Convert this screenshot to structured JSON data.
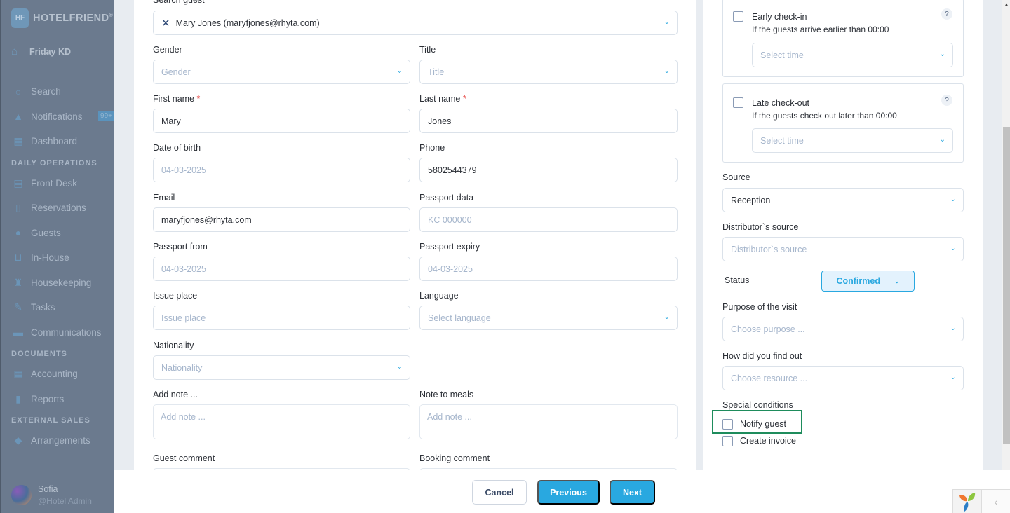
{
  "sidebar": {
    "brand": "HOTELFRIEND",
    "brand_mark": "®",
    "logo_letters": "HF",
    "hotel": "Friday KD",
    "items_top": [
      {
        "label": "Search",
        "icon": "search-icon"
      },
      {
        "label": "Notifications",
        "icon": "bell-icon",
        "badge": "99+"
      },
      {
        "label": "Dashboard",
        "icon": "dashboard-icon"
      }
    ],
    "section_daily": "DAILY OPERATIONS",
    "items_daily": [
      {
        "label": "Front Desk",
        "icon": "calendar-icon"
      },
      {
        "label": "Reservations",
        "icon": "document-icon"
      },
      {
        "label": "Guests",
        "icon": "person-icon"
      },
      {
        "label": "In-House",
        "icon": "cart-icon"
      },
      {
        "label": "Housekeeping",
        "icon": "broom-icon"
      },
      {
        "label": "Tasks",
        "icon": "wrench-icon"
      },
      {
        "label": "Communications",
        "icon": "chat-icon"
      }
    ],
    "section_documents": "DOCUMENTS",
    "items_documents": [
      {
        "label": "Accounting",
        "icon": "calculator-icon"
      },
      {
        "label": "Reports",
        "icon": "clipboard-icon"
      }
    ],
    "section_external": "EXTERNAL SALES",
    "items_external": [
      {
        "label": "Arrangements",
        "icon": "tag-icon"
      }
    ],
    "user": {
      "name": "Sofia",
      "role": "@Hotel Admin"
    }
  },
  "form": {
    "search_guest_label": "Search guest",
    "search_guest_value": "Mary Jones (maryfjones@rhyta.com)",
    "gender_label": "Gender",
    "gender_placeholder": "Gender",
    "title_label": "Title",
    "title_placeholder": "Title",
    "first_name_label": "First name",
    "first_name_value": "Mary",
    "last_name_label": "Last name",
    "last_name_value": "Jones",
    "required_mark": "*",
    "dob_label": "Date of birth",
    "dob_placeholder": "04-03-2025",
    "phone_label": "Phone",
    "phone_value": "5802544379",
    "email_label": "Email",
    "email_value": "maryfjones@rhyta.com",
    "passport_data_label": "Passport data",
    "passport_data_placeholder": "KC 000000",
    "passport_from_label": "Passport from",
    "passport_from_placeholder": "04-03-2025",
    "passport_expiry_label": "Passport expiry",
    "passport_expiry_placeholder": "04-03-2025",
    "issue_place_label": "Issue place",
    "issue_place_placeholder": "Issue place",
    "language_label": "Language",
    "language_placeholder": "Select language",
    "nationality_label": "Nationality",
    "nationality_placeholder": "Nationality",
    "add_note_label": "Add note ...",
    "add_note_placeholder": "Add note ...",
    "note_meals_label": "Note to meals",
    "note_meals_placeholder": "Add note ...",
    "guest_comment_label": "Guest comment",
    "booking_comment_label": "Booking comment"
  },
  "right": {
    "early_checkin_title": "Early check-in",
    "early_checkin_sub": "If the guests arrive earlier than 00:00",
    "late_checkout_title": "Late check-out",
    "late_checkout_sub": "If the guests check out later than 00:00",
    "select_time_placeholder": "Select time",
    "help": "?",
    "source_label": "Source",
    "source_value": "Reception",
    "distributor_label": "Distributor`s source",
    "distributor_placeholder": "Distributor`s source",
    "status_label": "Status",
    "status_value": "Confirmed",
    "purpose_label": "Purpose of the visit",
    "purpose_placeholder": "Choose purpose ...",
    "find_out_label": "How did you find out",
    "find_out_placeholder": "Choose resource ...",
    "special_label": "Special conditions",
    "notify_guest": "Notify guest",
    "create_invoice": "Create invoice"
  },
  "footer": {
    "cancel": "Cancel",
    "previous": "Previous",
    "next": "Next"
  },
  "colors": {
    "accent": "#29a8e0",
    "highlight_border": "#1e8c5c",
    "required": "#e53935"
  }
}
